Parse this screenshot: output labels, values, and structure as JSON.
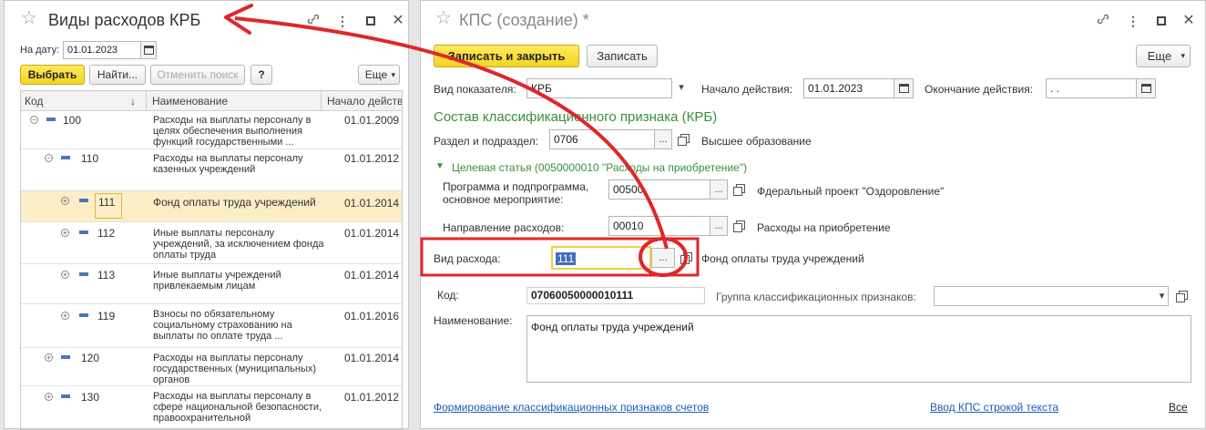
{
  "left": {
    "title": "Виды расходов КРБ",
    "date_label": "На дату:",
    "date_value": "01.01.2023",
    "select_btn": "Выбрать",
    "find_btn": "Найти...",
    "cancel_search_btn": "Отменить поиск",
    "help_btn": "?",
    "more_btn": "Еще",
    "columns": {
      "code": "Код",
      "sort": "↓",
      "name": "Наименование",
      "start": "Начало действи"
    },
    "rows": [
      {
        "code": "100",
        "name": "Расходы на выплаты персоналу в целях обеспечения выполнения функций государственными ...",
        "date": "01.01.2009",
        "expander": "−"
      },
      {
        "code": "110",
        "name": "Расходы на выплаты персоналу казенных учреждений",
        "date": "01.01.2012",
        "expander": "−"
      },
      {
        "code": "111",
        "name": "Фонд оплаты труда учреждений",
        "date": "01.01.2014",
        "expander": "+"
      },
      {
        "code": "112",
        "name": "Иные выплаты персоналу учреждений, за исключением фонда оплаты труда",
        "date": "01.01.2014",
        "expander": "+"
      },
      {
        "code": "113",
        "name": "Иные выплаты учреждений привлекаемым лицам",
        "date": "01.01.2014",
        "expander": "+"
      },
      {
        "code": "119",
        "name": "Взносы по обязательному социальному страхованию на выплаты по оплате труда ...",
        "date": "01.01.2016",
        "expander": "+"
      },
      {
        "code": "120",
        "name": "Расходы на выплаты персоналу государственных (муниципальных) органов",
        "date": "01.01.2014",
        "expander": "+"
      },
      {
        "code": "130",
        "name": "Расходы на выплаты персоналу в сфере национальной безопасности, правоохранительной",
        "date": "01.01.2012",
        "expander": "+"
      }
    ]
  },
  "right": {
    "title": "КПС (создание) *",
    "save_close_btn": "Записать и закрыть",
    "save_btn": "Записать",
    "more_btn": "Еще",
    "indicator_label": "Вид показателя:",
    "indicator_value": "КРБ",
    "start_label": "Начало действия:",
    "start_value": "01.01.2023",
    "end_label": "Окончание действия:",
    "end_value": " .  .",
    "section_title": "Состав классификационного признака (КРБ)",
    "razdel_label": "Раздел и подраздел:",
    "razdel_value": "0706",
    "razdel_desc": "Высшее образование",
    "target_group": "Целевая статья (0050000010 \"Расходы на приобретение\")",
    "program_label_1": "Программа и подпрограмма,",
    "program_label_2": "основное мероприятие:",
    "program_value": "00500",
    "program_desc": "Фдеральный проект \"Оздоровление\"",
    "direction_label": "Направление расходов:",
    "direction_value": "00010",
    "direction_desc": "Расходы на приобретение",
    "expense_label": "Вид расхода:",
    "expense_value": "111",
    "expense_desc": "Фонд оплаты труда учреждений",
    "code_label": "Код:",
    "code_value": "07060050000010111",
    "group_label": "Группа классификационных признаков:",
    "group_value": "",
    "name_label": "Наименование:",
    "name_value": "Фонд оплаты труда учреждений",
    "link_form": "Формирование классификационных признаков счетов",
    "link_input": "Ввод КПС строкой текста",
    "link_all": "Все",
    "ellipsis": "...",
    "dropdown": "▾"
  },
  "colors": {
    "accent_red": "#e0262a",
    "yellow": "#f4d323",
    "green": "#3a8f3a",
    "link": "#1e5db0"
  }
}
